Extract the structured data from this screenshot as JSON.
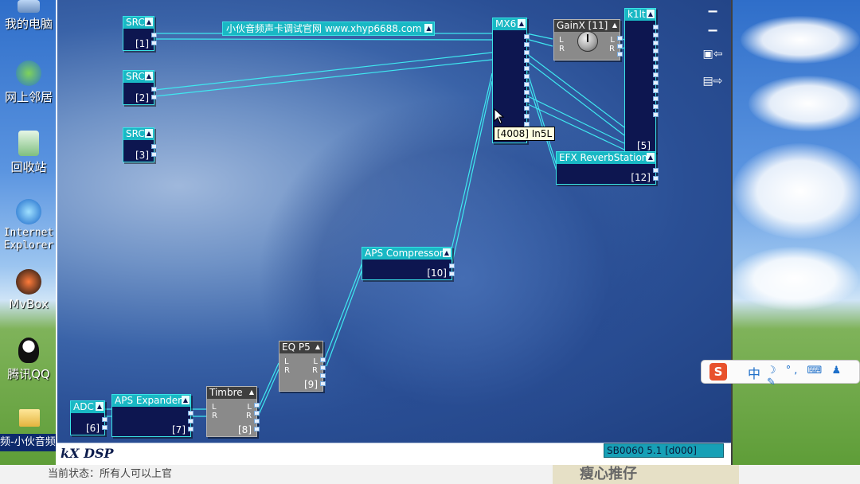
{
  "desktop": {
    "icons": [
      {
        "label": "我的电脑",
        "icon": "my-computer-icon"
      },
      {
        "label": "网上邻居",
        "icon": "network-icon"
      },
      {
        "label": "回收站",
        "icon": "recycle-bin-icon"
      },
      {
        "label": "Internet Explorer",
        "icon": "ie-icon"
      },
      {
        "label": "MvBox",
        "icon": "mvbox-icon"
      },
      {
        "label": "腾讯QQ",
        "icon": "qq-icon"
      }
    ]
  },
  "banner": {
    "text": "小伙音频声卡调试官网 www.xhyp6688.com"
  },
  "plugins": {
    "src1": {
      "title": "SRC",
      "index": "[1]"
    },
    "src2": {
      "title": "SRC",
      "index": "[2]"
    },
    "src3": {
      "title": "SRC",
      "index": "[3]"
    },
    "mx6": {
      "title": "MX6"
    },
    "gainx": {
      "title": "GainX [11]",
      "left": "L",
      "right": "R"
    },
    "k1lt": {
      "title": "k1lt",
      "index": "[5]"
    },
    "efx": {
      "title": "EFX ReverbStation",
      "index": "[12]"
    },
    "compressor": {
      "title": "APS Compressor",
      "index": "[10]"
    },
    "eq": {
      "title": "EQ P5",
      "index": "[9]",
      "left": "L",
      "right": "R"
    },
    "timbre": {
      "title": "Timbre",
      "index": "[8]",
      "left": "L",
      "right": "R"
    },
    "expander": {
      "title": "APS Expander",
      "index": "[7]"
    },
    "adc": {
      "title": "ADC",
      "index": "[6]"
    }
  },
  "tooltip": {
    "text": "[4008] In5L"
  },
  "statusbar": {
    "app_title": "kX DSP",
    "version": "SB0060 5.1 [d000]"
  },
  "taskbar": {
    "window_label": "频-小伙音频"
  },
  "page": {
    "state_text": "当前状态：所有人可以上官",
    "ad_text": "瘦心推仔"
  },
  "ime": {
    "logo": "S",
    "lang": "中",
    "tools": "☽ °, ⌨ ♟ ✎"
  }
}
